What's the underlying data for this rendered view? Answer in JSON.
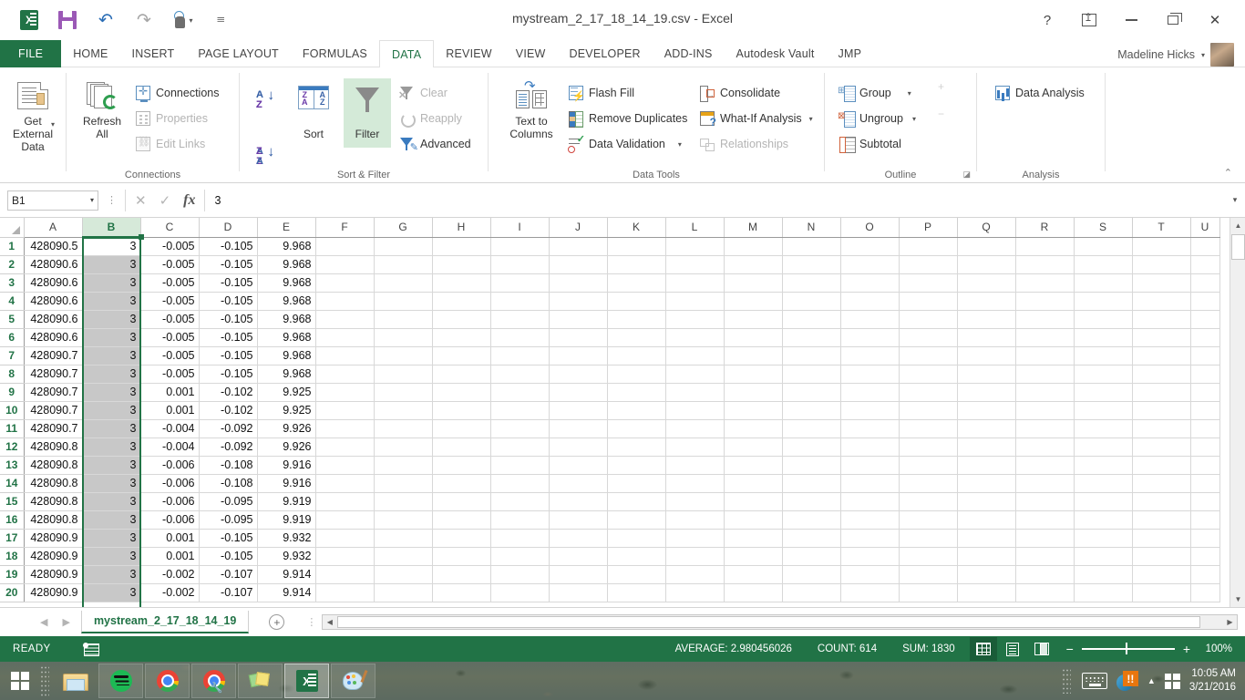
{
  "window": {
    "title": "mystream_2_17_18_14_19.csv - Excel",
    "user_name": "Madeline Hicks",
    "help_label": "?",
    "ribbon_display_label": "Ribbon Display Options",
    "minimize_label": "Minimize",
    "restore_label": "Restore Down",
    "close_label": "Close"
  },
  "qat": {
    "items": [
      {
        "name": "excel-logo-icon",
        "label": "Excel"
      },
      {
        "name": "save-icon",
        "label": "Save"
      },
      {
        "name": "undo-icon",
        "label": "Undo",
        "glyph": "↶"
      },
      {
        "name": "redo-icon",
        "label": "Redo",
        "glyph": "↷"
      },
      {
        "name": "touch-mode-icon",
        "label": "Touch/Mouse Mode"
      },
      {
        "name": "customize-qat-icon",
        "label": "Customize Quick Access Toolbar",
        "glyph": "⌄"
      }
    ]
  },
  "tabs": [
    {
      "label": "FILE",
      "active": false
    },
    {
      "label": "HOME",
      "active": false
    },
    {
      "label": "INSERT",
      "active": false
    },
    {
      "label": "PAGE LAYOUT",
      "active": false
    },
    {
      "label": "FORMULAS",
      "active": false
    },
    {
      "label": "DATA",
      "active": true
    },
    {
      "label": "REVIEW",
      "active": false
    },
    {
      "label": "VIEW",
      "active": false
    },
    {
      "label": "DEVELOPER",
      "active": false
    },
    {
      "label": "ADD-INS",
      "active": false
    },
    {
      "label": "Autodesk Vault",
      "active": false
    },
    {
      "label": "JMP",
      "active": false
    }
  ],
  "ribbon": {
    "groups": [
      {
        "name": "get-external-data",
        "label": "",
        "buttons": [
          {
            "label_line1": "Get External",
            "label_line2": "Data",
            "dropdown": true
          }
        ]
      },
      {
        "name": "connections",
        "label": "Connections",
        "big": {
          "label_line1": "Refresh",
          "label_line2": "All",
          "dropdown": true
        },
        "items": [
          {
            "label": "Connections",
            "disabled": false
          },
          {
            "label": "Properties",
            "disabled": true
          },
          {
            "label": "Edit Links",
            "disabled": true
          }
        ]
      },
      {
        "name": "sort-filter",
        "label": "Sort & Filter",
        "sort_label": "Sort",
        "filter_label": "Filter",
        "filter_active": true,
        "items": [
          {
            "label": "Clear",
            "disabled": true
          },
          {
            "label": "Reapply",
            "disabled": true
          },
          {
            "label": "Advanced",
            "disabled": false
          }
        ]
      },
      {
        "name": "data-tools",
        "label": "Data Tools",
        "big": {
          "label_line1": "Text to",
          "label_line2": "Columns"
        },
        "col1": [
          {
            "label": "Flash Fill",
            "disabled": false
          },
          {
            "label": "Remove Duplicates",
            "disabled": false
          },
          {
            "label": "Data Validation",
            "disabled": false,
            "dropdown": true
          }
        ],
        "col2": [
          {
            "label": "Consolidate",
            "disabled": false
          },
          {
            "label": "What-If Analysis",
            "disabled": false,
            "dropdown": true
          },
          {
            "label": "Relationships",
            "disabled": true
          }
        ]
      },
      {
        "name": "outline",
        "label": "Outline",
        "items": [
          {
            "label": "Group",
            "disabled": false,
            "dropdown": true
          },
          {
            "label": "Ungroup",
            "disabled": false,
            "dropdown": true
          },
          {
            "label": "Subtotal",
            "disabled": false
          }
        ],
        "detail_buttons": [
          "show-detail",
          "hide-detail"
        ]
      },
      {
        "name": "analysis",
        "label": "Analysis",
        "items": [
          {
            "label": "Data Analysis",
            "disabled": false
          }
        ]
      }
    ],
    "collapse_label": "Collapse the Ribbon"
  },
  "formula_bar": {
    "name_box": "B1",
    "cancel_label": "Cancel",
    "enter_label": "Enter",
    "fx_label": "Insert Function",
    "value": "3",
    "expand_label": "Expand Formula Bar"
  },
  "grid": {
    "columns": [
      "A",
      "B",
      "C",
      "D",
      "E",
      "F",
      "G",
      "H",
      "I",
      "J",
      "K",
      "L",
      "M",
      "N",
      "O",
      "P",
      "Q",
      "R",
      "S",
      "T",
      "U"
    ],
    "selected_column": "B",
    "active_cell": "B1",
    "rows": [
      {
        "n": "1",
        "cells": [
          "428090.5",
          "3",
          "-0.005",
          "-0.105",
          "9.968"
        ]
      },
      {
        "n": "2",
        "cells": [
          "428090.6",
          "3",
          "-0.005",
          "-0.105",
          "9.968"
        ]
      },
      {
        "n": "3",
        "cells": [
          "428090.6",
          "3",
          "-0.005",
          "-0.105",
          "9.968"
        ]
      },
      {
        "n": "4",
        "cells": [
          "428090.6",
          "3",
          "-0.005",
          "-0.105",
          "9.968"
        ]
      },
      {
        "n": "5",
        "cells": [
          "428090.6",
          "3",
          "-0.005",
          "-0.105",
          "9.968"
        ]
      },
      {
        "n": "6",
        "cells": [
          "428090.6",
          "3",
          "-0.005",
          "-0.105",
          "9.968"
        ]
      },
      {
        "n": "7",
        "cells": [
          "428090.7",
          "3",
          "-0.005",
          "-0.105",
          "9.968"
        ]
      },
      {
        "n": "8",
        "cells": [
          "428090.7",
          "3",
          "-0.005",
          "-0.105",
          "9.968"
        ]
      },
      {
        "n": "9",
        "cells": [
          "428090.7",
          "3",
          "0.001",
          "-0.102",
          "9.925"
        ]
      },
      {
        "n": "10",
        "cells": [
          "428090.7",
          "3",
          "0.001",
          "-0.102",
          "9.925"
        ]
      },
      {
        "n": "11",
        "cells": [
          "428090.7",
          "3",
          "-0.004",
          "-0.092",
          "9.926"
        ]
      },
      {
        "n": "12",
        "cells": [
          "428090.8",
          "3",
          "-0.004",
          "-0.092",
          "9.926"
        ]
      },
      {
        "n": "13",
        "cells": [
          "428090.8",
          "3",
          "-0.006",
          "-0.108",
          "9.916"
        ]
      },
      {
        "n": "14",
        "cells": [
          "428090.8",
          "3",
          "-0.006",
          "-0.108",
          "9.916"
        ]
      },
      {
        "n": "15",
        "cells": [
          "428090.8",
          "3",
          "-0.006",
          "-0.095",
          "9.919"
        ]
      },
      {
        "n": "16",
        "cells": [
          "428090.8",
          "3",
          "-0.006",
          "-0.095",
          "9.919"
        ]
      },
      {
        "n": "17",
        "cells": [
          "428090.9",
          "3",
          "0.001",
          "-0.105",
          "9.932"
        ]
      },
      {
        "n": "18",
        "cells": [
          "428090.9",
          "3",
          "0.001",
          "-0.105",
          "9.932"
        ]
      },
      {
        "n": "19",
        "cells": [
          "428090.9",
          "3",
          "-0.002",
          "-0.107",
          "9.914"
        ]
      },
      {
        "n": "20",
        "cells": [
          "428090.9",
          "3",
          "-0.002",
          "-0.107",
          "9.914"
        ]
      }
    ]
  },
  "sheet_bar": {
    "first_label": "◀",
    "prev_label": "◀",
    "next_label": "▶",
    "tabs": [
      {
        "label": "mystream_2_17_18_14_19",
        "active": true
      }
    ],
    "add_sheet_label": "+"
  },
  "status_bar": {
    "mode": "READY",
    "macro_record_label": "Record Macro",
    "average": "AVERAGE: 2.980456026",
    "count": "COUNT: 614",
    "sum": "SUM: 1830",
    "views": [
      {
        "name": "normal-view-button",
        "label": "Normal",
        "active": true
      },
      {
        "name": "page-layout-view-button",
        "label": "Page Layout",
        "active": false
      },
      {
        "name": "page-break-view-button",
        "label": "Page Break Preview",
        "active": false
      }
    ],
    "zoom_out_label": "−",
    "zoom_in_label": "+",
    "zoom_level": "100%"
  },
  "taskbar": {
    "start_label": "Start",
    "items": [
      {
        "name": "taskbar-file-explorer",
        "label": "File Explorer",
        "active": false
      },
      {
        "name": "taskbar-spotify",
        "label": "Spotify",
        "active": false
      },
      {
        "name": "taskbar-chrome",
        "label": "Google Chrome",
        "active": false
      },
      {
        "name": "taskbar-chrome-dev",
        "label": "Chrome Developer",
        "active": false
      },
      {
        "name": "taskbar-sticky-notes",
        "label": "Sticky Notes",
        "active": false
      },
      {
        "name": "taskbar-excel",
        "label": "Excel",
        "active": true
      },
      {
        "name": "taskbar-paint",
        "label": "Paint",
        "active": false
      }
    ],
    "tray": {
      "keyboard_label": "Touch Keyboard",
      "alert_badge": "!!",
      "alert_label": "Notifications",
      "chevron_label": "Show hidden icons",
      "action_center_label": "Action Center"
    },
    "clock": {
      "time": "10:05 AM",
      "date": "3/21/2016"
    }
  },
  "colors": {
    "excel_green": "#217346",
    "selection_gray": "#c8c8c8",
    "filter_highlight": "#d4ead8",
    "header_selected": "#d6e9d9"
  }
}
